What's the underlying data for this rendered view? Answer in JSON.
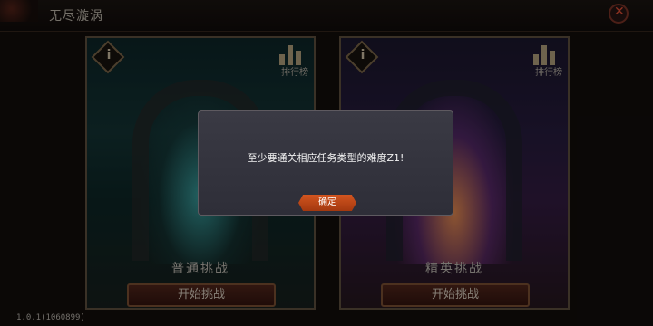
{
  "header": {
    "title": "无尽漩涡"
  },
  "cards": [
    {
      "title": "普通挑战",
      "rank_label": "排行榜",
      "start_label": "开始挑战"
    },
    {
      "title": "精英挑战",
      "rank_label": "排行榜",
      "start_label": "开始挑战"
    }
  ],
  "dialog": {
    "message": "至少要通关相应任务类型的难度Z1!",
    "confirm_label": "确定"
  },
  "footer": {
    "version": "1.0.1(1060899)"
  },
  "icons": {
    "close": "close-icon",
    "info": "info-icon",
    "ranking": "leaderboard-icon"
  },
  "colors": {
    "confirm": "#c64a1a",
    "close": "#ff5a3d",
    "start_button": "#4a1f15"
  }
}
